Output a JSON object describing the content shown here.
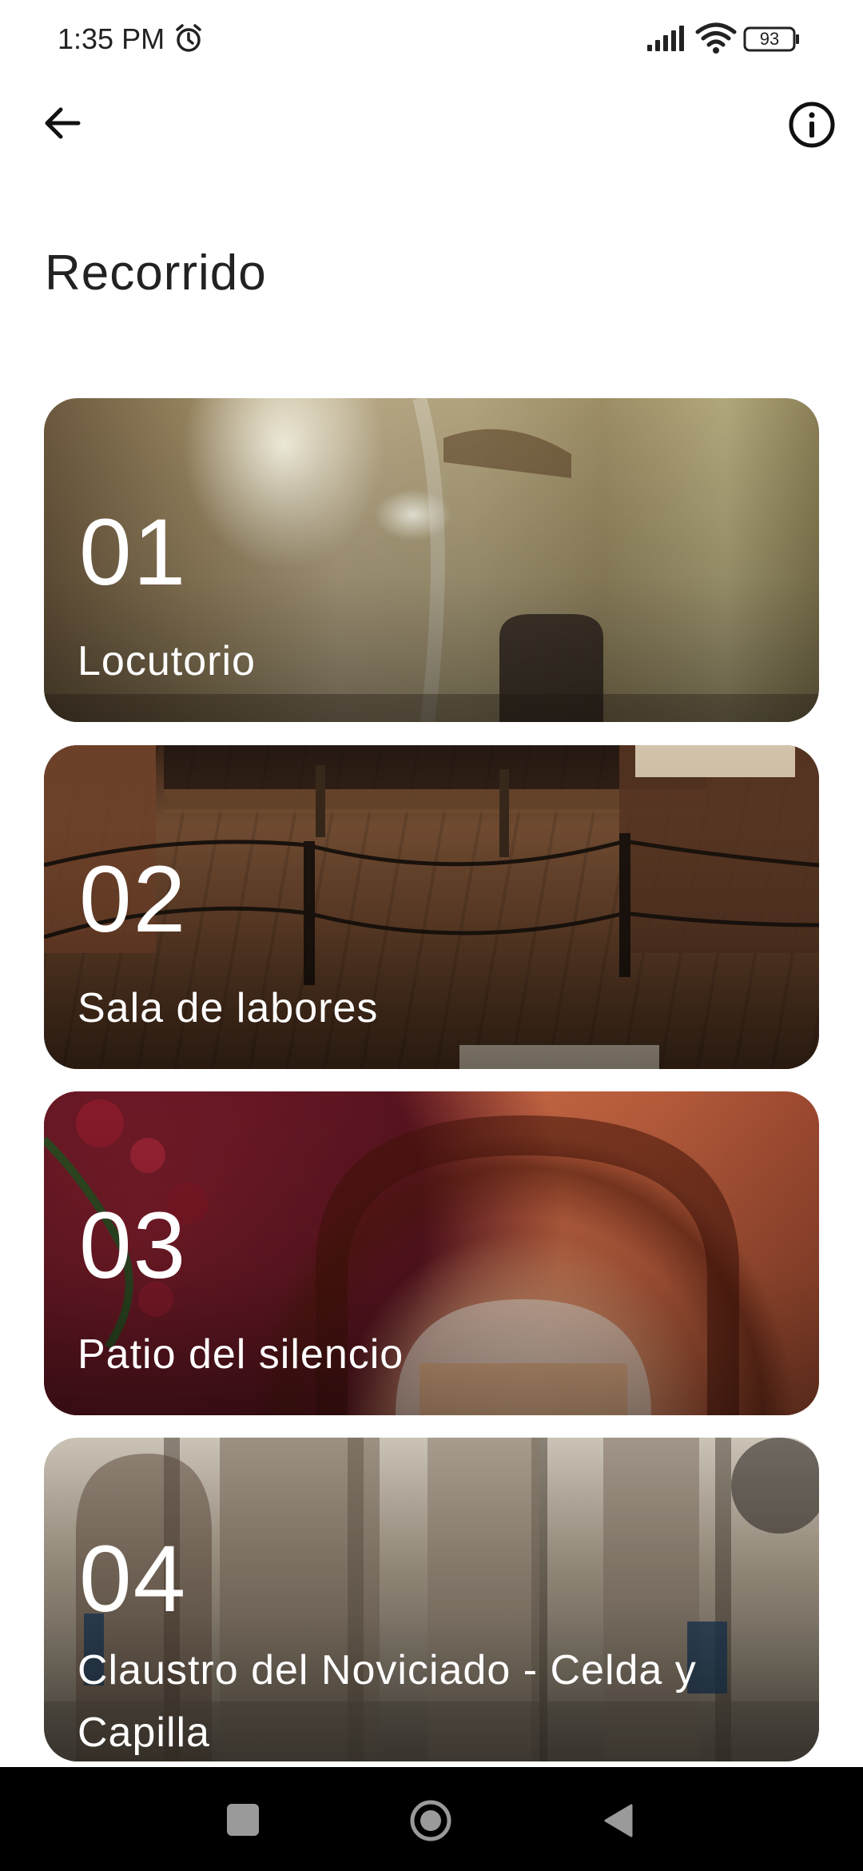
{
  "status_bar": {
    "time": "1:35 PM",
    "battery": "93",
    "icons": [
      "alarm-icon",
      "signal-icon",
      "wifi-icon",
      "battery-icon"
    ]
  },
  "header": {
    "back_icon": "arrow-left-icon",
    "info_icon": "info-circle-icon"
  },
  "page": {
    "title": "Recorrido"
  },
  "stops": [
    {
      "number": "01",
      "name": "Locutorio"
    },
    {
      "number": "02",
      "name": "Sala de labores"
    },
    {
      "number": "03",
      "name": "Patio del silencio"
    },
    {
      "number": "04",
      "name": "Claustro del Noviciado - Celda y Capilla"
    }
  ],
  "nav_bar": {
    "icons": [
      "recents-square-icon",
      "home-circle-icon",
      "back-triangle-icon"
    ]
  }
}
